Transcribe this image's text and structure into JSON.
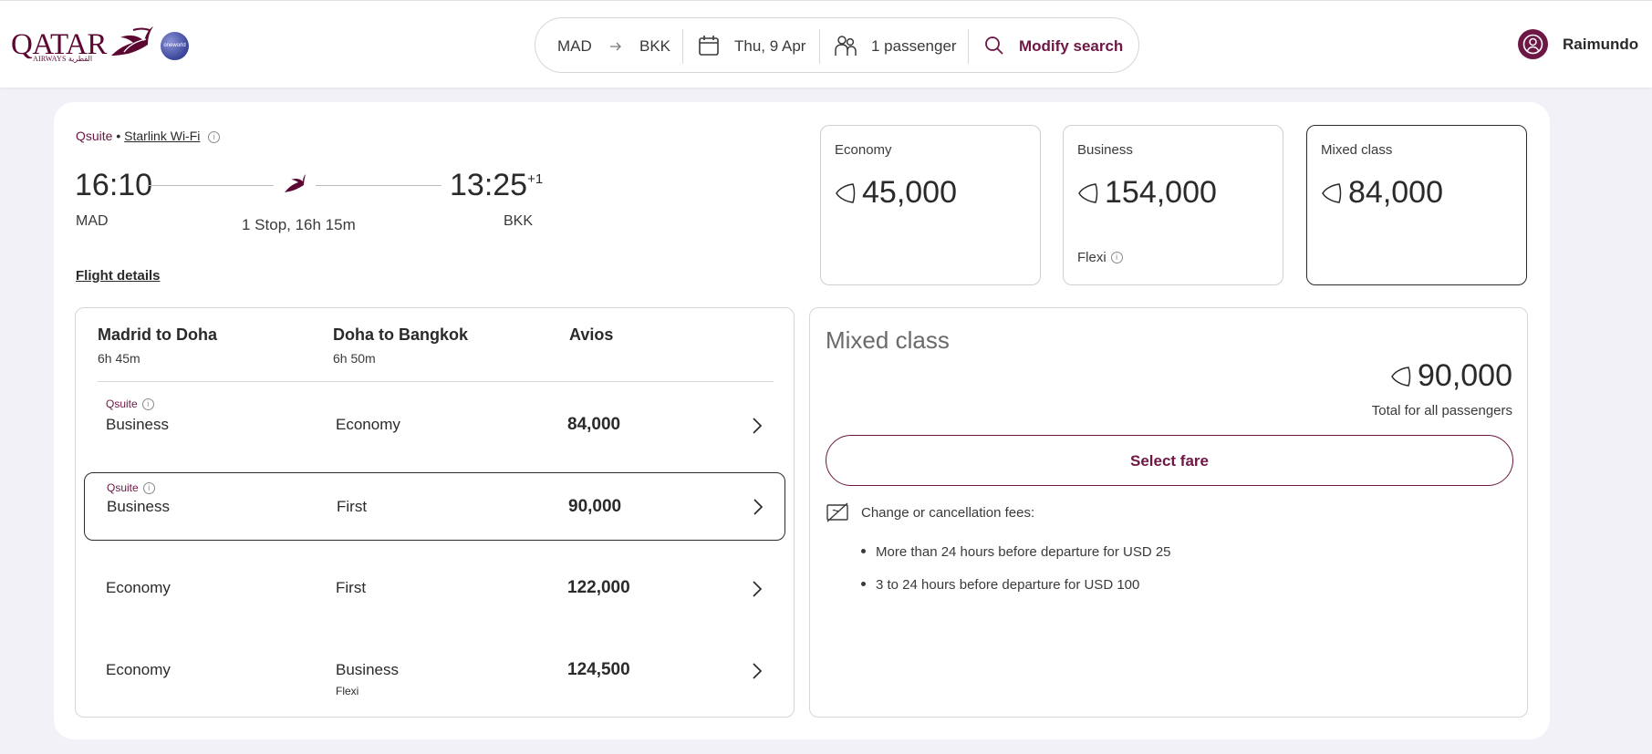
{
  "header": {
    "logo_text": "QATAR",
    "logo_sub": "AIRWAYS القطرية",
    "oneworld_label": "oneworld",
    "search": {
      "origin": "MAD",
      "destination": "BKK",
      "date": "Thu, 9 Apr",
      "passengers": "1 passenger",
      "modify_label": "Modify search"
    },
    "user_name": "Raimundo"
  },
  "flight": {
    "cabin_tag": "Qsuite",
    "separator": "•",
    "wifi": "Starlink Wi-Fi",
    "departure_time": "16:10",
    "arrival_time": "13:25",
    "arrival_day_offset": "+1",
    "origin_code": "MAD",
    "destination_code": "BKK",
    "stops_duration": "1 Stop, 16h 15m",
    "details_link": "Flight details"
  },
  "fares": [
    {
      "label": "Economy",
      "avios": "45,000",
      "note": ""
    },
    {
      "label": "Business",
      "avios": "154,000",
      "note": "Flexi"
    },
    {
      "label": "Mixed class",
      "avios": "84,000",
      "note": ""
    }
  ],
  "mixed_table": {
    "headers": [
      {
        "title": "Madrid to Doha",
        "sub": "6h 45m"
      },
      {
        "title": "Doha to Bangkok",
        "sub": "6h 50m"
      },
      {
        "title": "Avios",
        "sub": ""
      }
    ],
    "rows": [
      {
        "tag": "Qsuite",
        "leg1": "Business",
        "leg2": "Economy",
        "avios": "84,000",
        "note": ""
      },
      {
        "tag": "Qsuite",
        "leg1": "Business",
        "leg2": "First",
        "avios": "90,000",
        "note": ""
      },
      {
        "tag": "",
        "leg1": "Economy",
        "leg2": "First",
        "avios": "122,000",
        "note": ""
      },
      {
        "tag": "",
        "leg1": "Economy",
        "leg2": "Business",
        "avios": "124,500",
        "note": "Flexi"
      }
    ]
  },
  "summary": {
    "title": "Mixed class",
    "avios": "90,000",
    "total_label": "Total for all passengers",
    "select_label": "Select fare",
    "fees_title": "Change or cancellation fees:",
    "fees": [
      "More than 24 hours before departure for USD 25",
      "3 to 24 hours before departure for USD 100"
    ]
  },
  "colors": {
    "brand": "#6d1745",
    "page_bg": "#f1f1f7",
    "text": "#2a2a2a"
  }
}
